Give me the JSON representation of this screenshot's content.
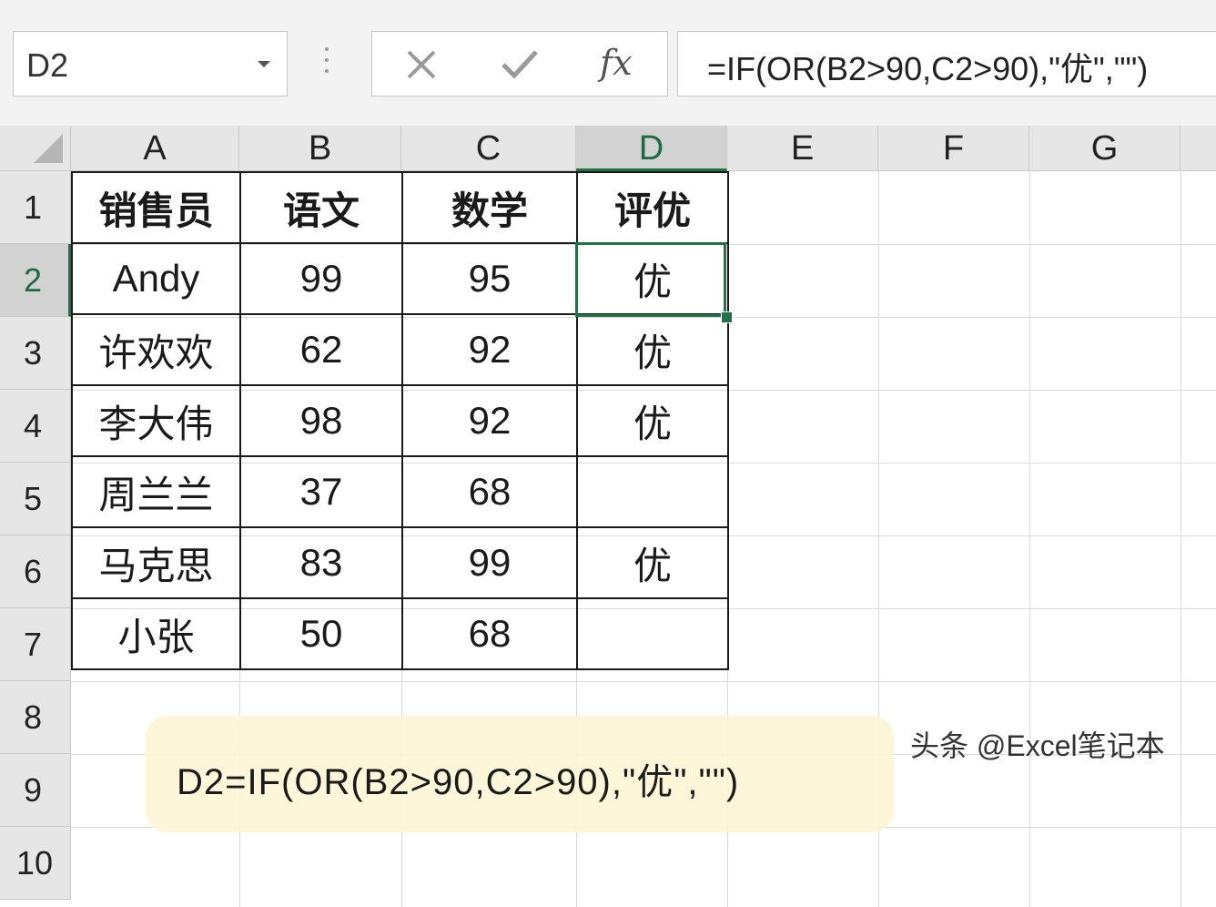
{
  "formula_bar": {
    "name_box": "D2",
    "formula": "=IF(OR(B2>90,C2>90),\"优\",\"\")",
    "cancel_icon": "x-cancel-icon",
    "enter_icon": "check-enter-icon",
    "fx_label": "fx"
  },
  "sheet": {
    "columns": [
      "A",
      "B",
      "C",
      "D",
      "E",
      "F",
      "G"
    ],
    "rows": [
      "1",
      "2",
      "3",
      "4",
      "5",
      "6",
      "7",
      "8",
      "9",
      "10"
    ],
    "active_cell": "D2",
    "table": {
      "headers": [
        "销售员",
        "语文",
        "数学",
        "评优"
      ],
      "rows": [
        [
          "Andy",
          "99",
          "95",
          "优"
        ],
        [
          "许欢欢",
          "62",
          "92",
          "优"
        ],
        [
          "李大伟",
          "98",
          "92",
          "优"
        ],
        [
          "周兰兰",
          "37",
          "68",
          ""
        ],
        [
          "马克思",
          "83",
          "99",
          "优"
        ],
        [
          "小张",
          "50",
          "68",
          ""
        ]
      ]
    }
  },
  "note": "D2=IF(OR(B2>90,C2>90),\"优\",\"\")",
  "watermark": "头条 @Excel笔记本",
  "colors": {
    "selection": "#217346",
    "note_background": "#fef5d6",
    "header_background": "#e6e6e6"
  }
}
